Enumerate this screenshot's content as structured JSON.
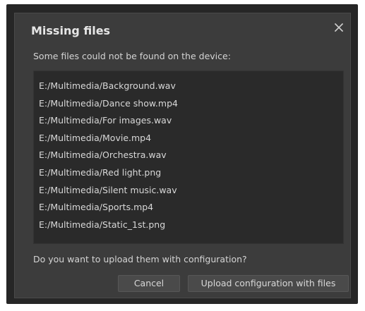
{
  "dialog": {
    "title": "Missing files",
    "message": "Some files could not be found on the device:",
    "question": "Do you want to upload them with configuration?",
    "close_icon": "close-x-icon"
  },
  "files": [
    "E:/Multimedia/Background.wav",
    "E:/Multimedia/Dance show.mp4",
    "E:/Multimedia/For images.wav",
    "E:/Multimedia/Movie.mp4",
    "E:/Multimedia/Orchestra.wav",
    "E:/Multimedia/Red light.png",
    "E:/Multimedia/Silent music.wav",
    "E:/Multimedia/Sports.mp4",
    "E:/Multimedia/Static_1st.png"
  ],
  "buttons": {
    "cancel_label": "Cancel",
    "upload_label": "Upload configuration with files"
  },
  "colors": {
    "dialog_background": "#3c3c3c",
    "list_background": "#2a2a2a",
    "text": "#d8d8d8"
  }
}
